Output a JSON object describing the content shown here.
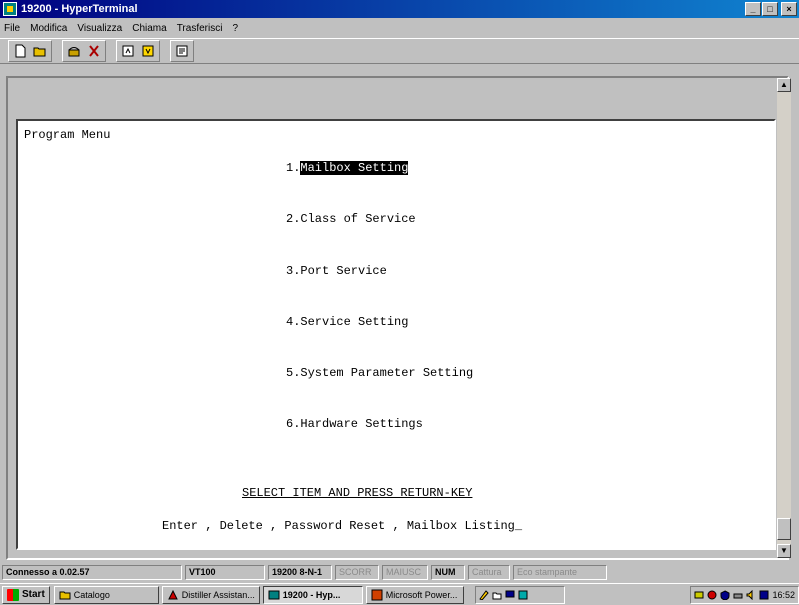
{
  "window": {
    "title": "19200 - HyperTerminal",
    "minimize": "_",
    "maximize": "□",
    "close": "×"
  },
  "menu": [
    "File",
    "Modifica",
    "Visualizza",
    "Chiama",
    "Trasferisci",
    "?"
  ],
  "terminal": {
    "heading": "Program Menu",
    "items": [
      "1.Mailbox Setting",
      "2.Class of Service",
      "3.Port Service",
      "4.Service Setting",
      "5.System Parameter Setting",
      "6.Hardware Settings"
    ],
    "instruction": "SELECT ITEM AND PRESS RETURN-KEY",
    "command_line": "Enter , Delete , Password Reset , Mailbox Listing",
    "cursor": "_"
  },
  "status": {
    "connected": "Connesso a 0.02.57",
    "emulation": "VT100",
    "settings": "19200 8-N-1",
    "scroll": "SCORR",
    "caps": "MAIUSC",
    "num": "NUM",
    "capture": "Cattura",
    "echo": "Eco stampante"
  },
  "taskbar": {
    "start": "Start",
    "tasks": [
      "Catalogo",
      "Distiller Assistan...",
      "19200 - Hyp...",
      "Microsoft Power..."
    ],
    "clock": "16:52"
  }
}
